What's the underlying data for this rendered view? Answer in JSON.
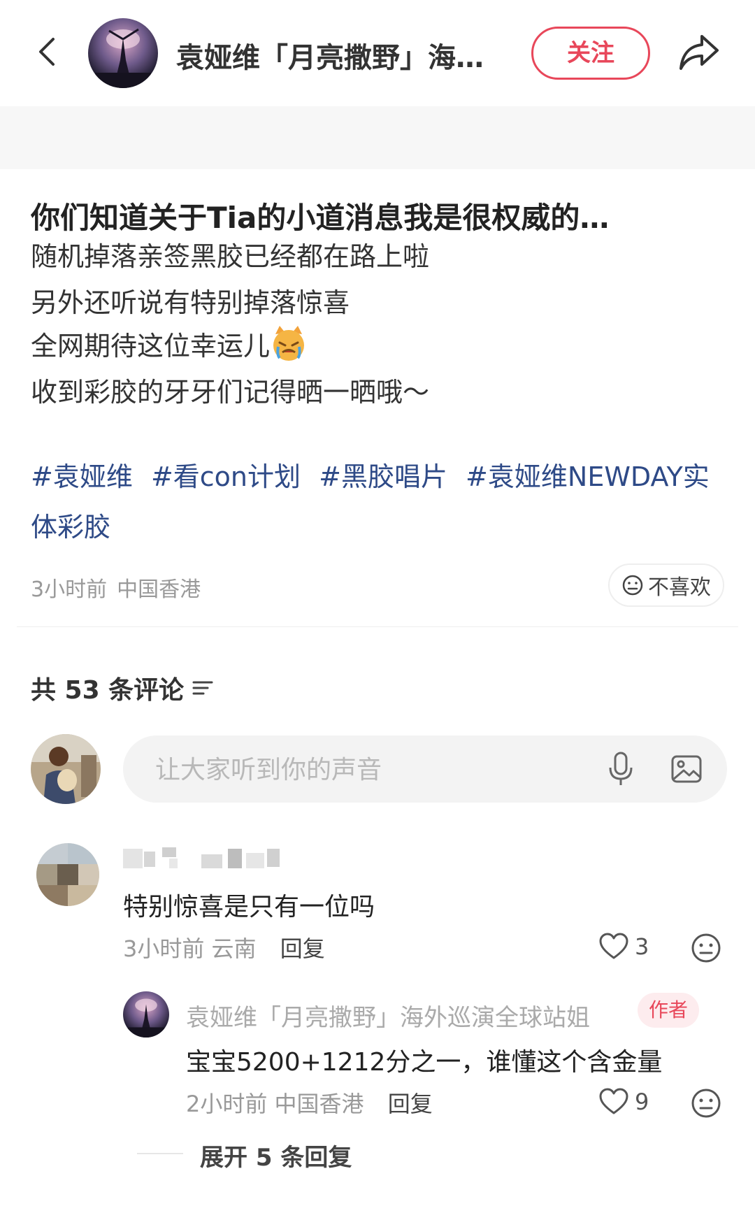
{
  "header": {
    "back_icon": "chevron-left-icon",
    "account_name": "袁娅维「月亮撒野」海外…",
    "follow_label": "关注",
    "share_icon": "share-arrow-icon"
  },
  "post": {
    "title": "你们知道关于Tia的小道消息我是很权威的…",
    "lines": [
      "随机掉落亲签黑胶已经都在路上啦",
      "另外还听说有特别掉落惊喜",
      "全网期待这位幸运儿",
      "收到彩胶的牙牙们记得晒一晒哦～"
    ],
    "emoji": "crying-cat-face",
    "tags": [
      "#袁娅维",
      "#看con计划",
      "#黑胶唱片",
      "#袁娅维NEWDAY实体彩胶"
    ],
    "time": "3小时前",
    "location": "中国香港",
    "dislike_label": "不喜欢"
  },
  "comments_section": {
    "count_label": "共 53 条评论",
    "input_placeholder": "让大家听到你的声音",
    "comments": [
      {
        "text": "特别惊喜是只有一位吗",
        "time": "3小时前",
        "location": "云南",
        "reply_label": "回复",
        "likes": "3"
      }
    ],
    "reply": {
      "name": "袁娅维「月亮撒野」海外巡演全球站姐",
      "badge": "作者",
      "text": "宝宝5200+1212分之一，谁懂这个含金量",
      "time": "2小时前",
      "location": "中国香港",
      "reply_label": "回复",
      "likes": "9"
    },
    "expand_label": "展开 5 条回复"
  },
  "colors": {
    "accent": "#e8475a",
    "tag": "#2e4a87",
    "muted": "#999999"
  }
}
